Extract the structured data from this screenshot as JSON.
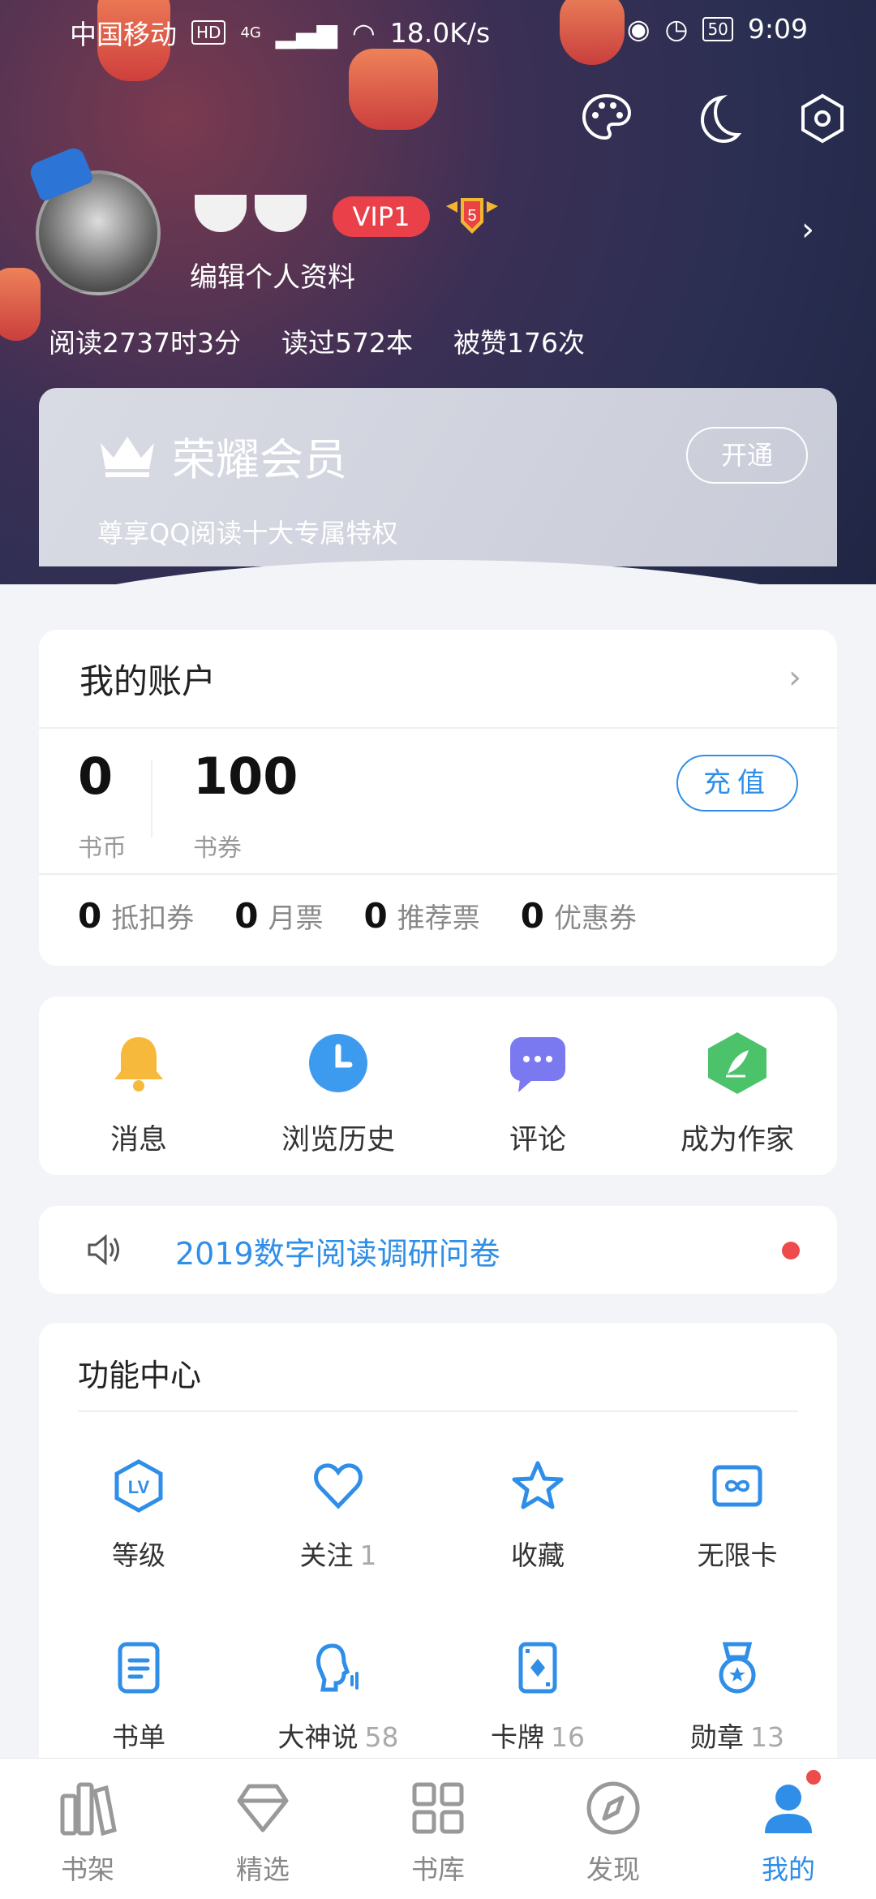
{
  "status_bar": {
    "carrier": "中国移动",
    "hd": "HD",
    "net": "4G",
    "speed": "18.0K/s",
    "battery": "50",
    "time": "9:09"
  },
  "profile": {
    "vip_label": "VIP1",
    "level": "5",
    "edit_label": "编辑个人资料",
    "stats": [
      "阅读2737时3分",
      "读过572本",
      "被赞176次"
    ]
  },
  "vip_card": {
    "title": "荣耀会员",
    "subtitle": "尊享QQ阅读十大专属特权",
    "open_label": "开通"
  },
  "account": {
    "title": "我的账户",
    "coins_value": "0",
    "coins_label": "书币",
    "vouchers_value": "100",
    "vouchers_label": "书券",
    "recharge_label": "充值",
    "tickets": [
      {
        "value": "0",
        "label": "抵扣券"
      },
      {
        "value": "0",
        "label": "月票"
      },
      {
        "value": "0",
        "label": "推荐票"
      },
      {
        "value": "0",
        "label": "优惠券"
      }
    ]
  },
  "quick_actions": [
    {
      "label": "消息",
      "icon": "bell-icon"
    },
    {
      "label": "浏览历史",
      "icon": "clock-icon"
    },
    {
      "label": "评论",
      "icon": "comment-icon"
    },
    {
      "label": "成为作家",
      "icon": "pen-icon"
    }
  ],
  "notice": {
    "text": "2019数字阅读调研问卷"
  },
  "function_center": {
    "title": "功能中心",
    "items": [
      {
        "label": "等级",
        "count": "",
        "icon": "level-icon"
      },
      {
        "label": "关注",
        "count": "1",
        "icon": "heart-icon"
      },
      {
        "label": "收藏",
        "count": "",
        "icon": "star-icon"
      },
      {
        "label": "无限卡",
        "count": "",
        "icon": "infinity-card-icon"
      },
      {
        "label": "书单",
        "count": "",
        "icon": "booklist-icon"
      },
      {
        "label": "大神说",
        "count": "58",
        "icon": "speaker-head-icon"
      },
      {
        "label": "卡牌",
        "count": "16",
        "icon": "card-icon"
      },
      {
        "label": "勋章",
        "count": "13",
        "icon": "medal-icon"
      }
    ]
  },
  "bottom_nav": [
    {
      "label": "书架",
      "icon": "bookshelf-icon"
    },
    {
      "label": "精选",
      "icon": "diamond-icon"
    },
    {
      "label": "书库",
      "icon": "grid-icon"
    },
    {
      "label": "发现",
      "icon": "compass-icon"
    },
    {
      "label": "我的",
      "icon": "user-icon"
    }
  ],
  "colors": {
    "accent": "#2f8ee8",
    "vip_red": "#e9404a",
    "dot_red": "#ee4b4b"
  }
}
